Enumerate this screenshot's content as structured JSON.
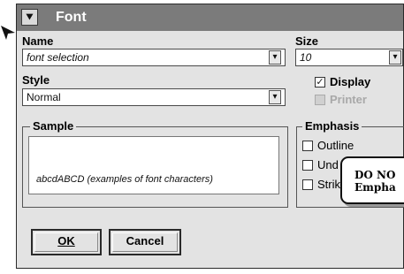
{
  "window": {
    "title": "Font",
    "sysmenu_glyph": "⯆"
  },
  "name": {
    "label": "Name",
    "value": "font selection"
  },
  "size": {
    "label": "Size",
    "value": "10"
  },
  "style": {
    "label": "Style",
    "value": "Normal"
  },
  "display_checkbox": {
    "label": "Display",
    "checked": true
  },
  "printer_checkbox": {
    "label": "Printer",
    "checked": false,
    "enabled": false
  },
  "sample": {
    "label": "Sample",
    "text": "abcdABCD   (examples of font characters)"
  },
  "emphasis": {
    "label": "Emphasis",
    "items": [
      {
        "label": "Outline",
        "checked": false
      },
      {
        "label": "Und",
        "checked": false
      },
      {
        "label": "Strik",
        "checked": false
      }
    ]
  },
  "buttons": {
    "ok": "OK",
    "cancel": "Cancel"
  },
  "callout": {
    "text": "DO NO\nEmpha"
  },
  "colors": {
    "titlebar": "#7b7b7b",
    "dialog_bg": "#e3e3e3"
  },
  "icons": {
    "dropdown": "chevron-down-icon",
    "check": "checkmark-icon",
    "pointer": "pointer-arrow-icon"
  }
}
